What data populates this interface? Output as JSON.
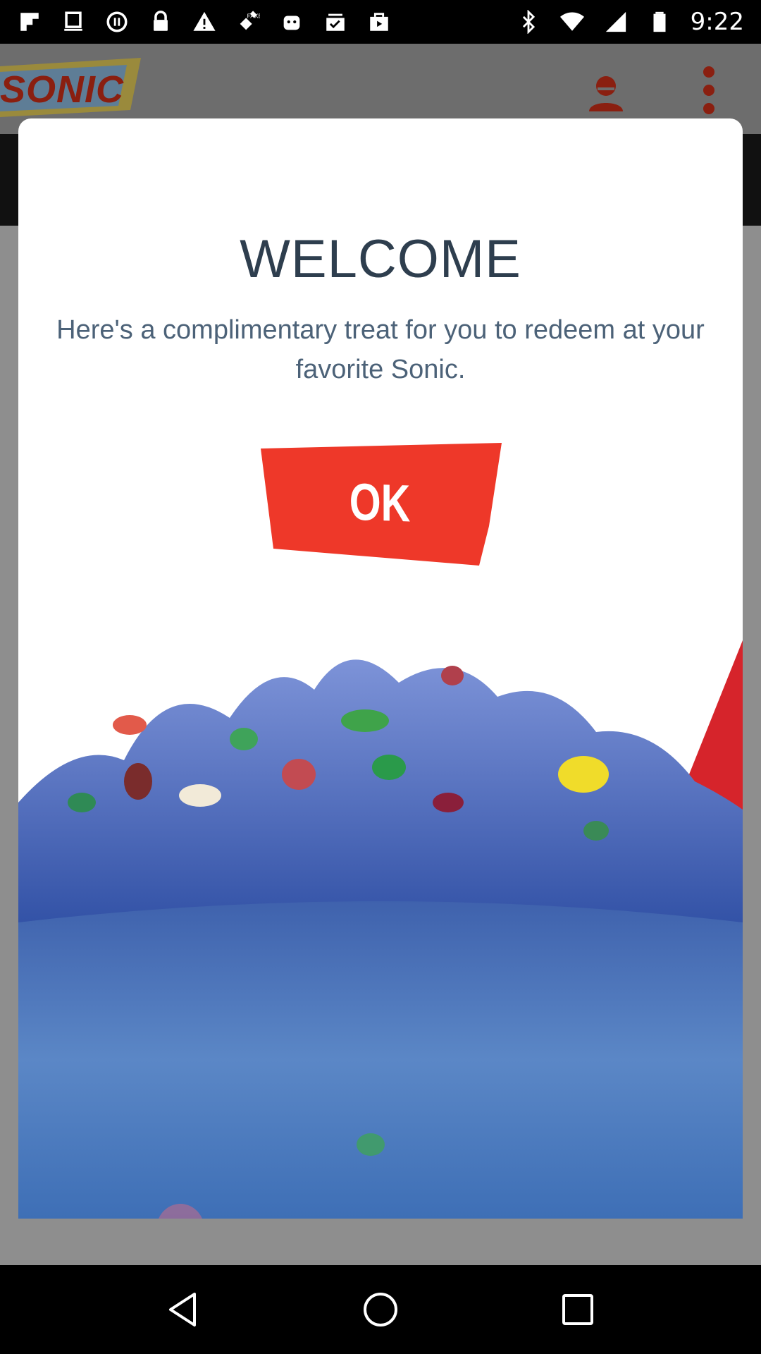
{
  "status_bar": {
    "time": "9:22",
    "left_icons": [
      "flipboard-icon",
      "notification-icon",
      "media-icon",
      "lock-icon",
      "warning-icon",
      "fake-gps-icon",
      "android-icon",
      "checked-box-icon",
      "play-store-icon"
    ],
    "right_icons": [
      "bluetooth-icon",
      "wifi-icon",
      "signal-icon",
      "battery-icon"
    ]
  },
  "app": {
    "logo_text": "SONIC",
    "profile_icon": "profile-icon",
    "menu_icon": "more-vert-icon"
  },
  "modal": {
    "title": "WELCOME",
    "body": "Here's a complimentary treat for you to redeem at your favorite Sonic.",
    "ok_label": "OK",
    "ok_color": "#ee3829",
    "image": "blue-slush-treat-image"
  },
  "nav_bar": {
    "back": "back-icon",
    "home": "home-icon",
    "recents": "recents-icon"
  }
}
